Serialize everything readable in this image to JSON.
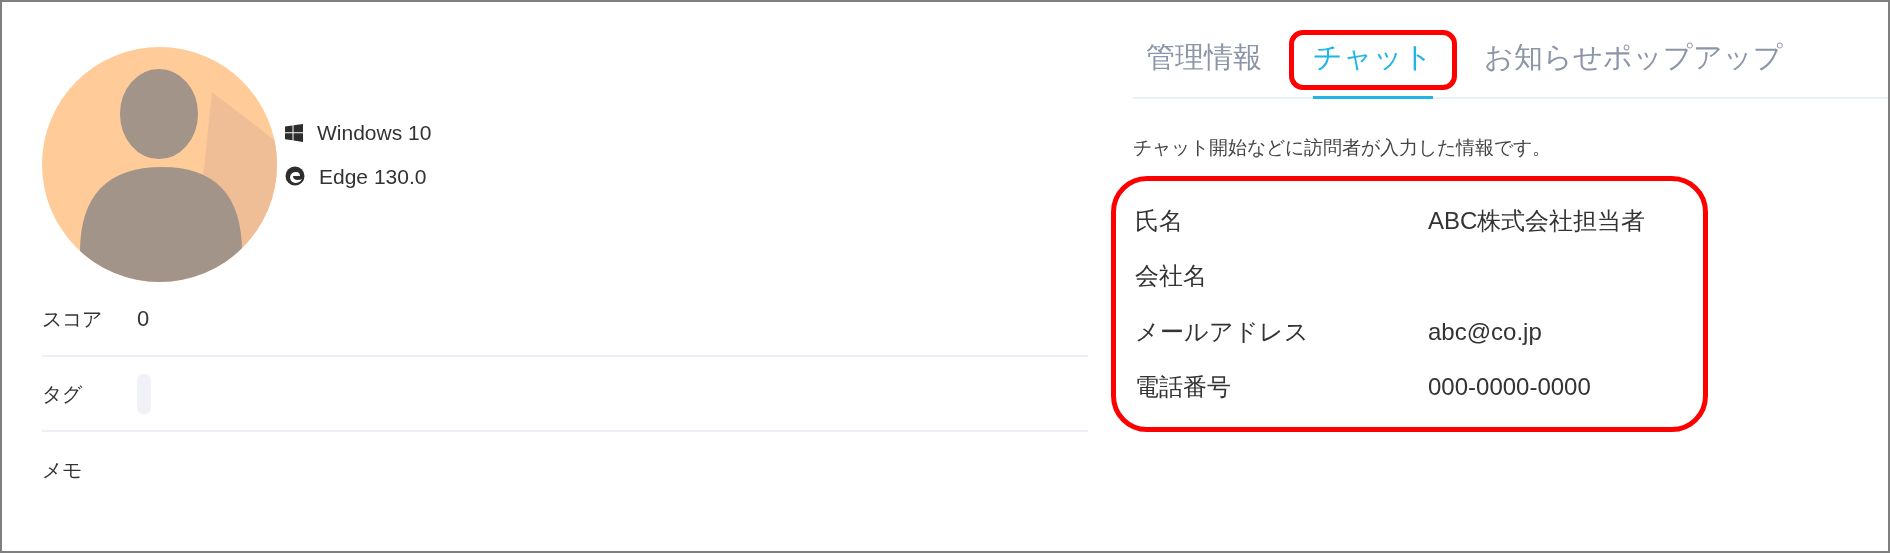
{
  "visitor": {
    "os": "Windows 10",
    "browser": "Edge 130.0"
  },
  "fields": [
    {
      "label": "スコア",
      "kind": "text",
      "value": "0"
    },
    {
      "label": "タグ",
      "kind": "tags"
    },
    {
      "label": "メモ",
      "kind": "text"
    }
  ],
  "tabs": [
    {
      "label": "管理情報",
      "selected": false,
      "highlighted": false
    },
    {
      "label": "チャット",
      "selected": true,
      "highlighted": true
    },
    {
      "label": "お知らせポップアップ",
      "selected": false,
      "highlighted": false
    }
  ],
  "chat_info": {
    "description": "チャット開始などに訪問者が入力した情報です。",
    "highlighted": true,
    "rows": [
      {
        "label": "氏名",
        "value": "ABC株式会社担当者"
      },
      {
        "label": "会社名"
      },
      {
        "label": "メールアドレス",
        "value": "abc@co.jp"
      },
      {
        "label": "電話番号",
        "value": "000-0000-0000"
      }
    ]
  }
}
